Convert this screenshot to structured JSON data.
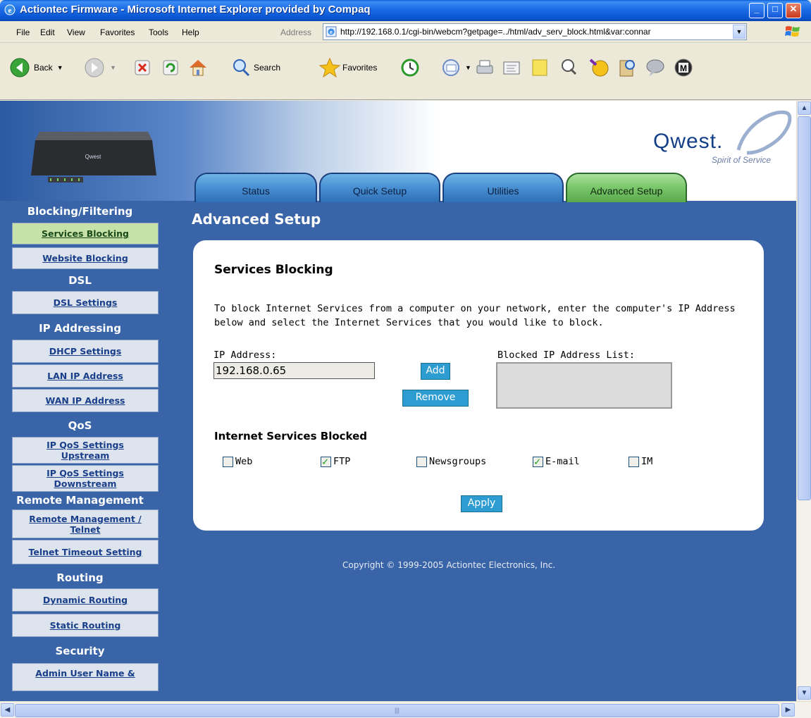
{
  "window": {
    "title": "Actiontec Firmware - Microsoft Internet Explorer provided by Compaq"
  },
  "menu": [
    "File",
    "Edit",
    "View",
    "Favorites",
    "Tools",
    "Help"
  ],
  "address": {
    "label": "Address",
    "url": "http://192.168.0.1/cgi-bin/webcm?getpage=../html/adv_serv_block.html&var:connar"
  },
  "toolbar": {
    "back": "Back",
    "search": "Search",
    "favorites": "Favorites"
  },
  "brand": {
    "name": "Qwest.",
    "tagline": "Spirit of Service"
  },
  "tabs": [
    "Status",
    "Quick Setup",
    "Utilities",
    "Advanced Setup"
  ],
  "sidebar": {
    "sections": [
      {
        "head": "Blocking/Filtering",
        "links": [
          "Services Blocking",
          "Website Blocking"
        ]
      },
      {
        "head": "DSL",
        "links": [
          "DSL Settings"
        ]
      },
      {
        "head": "IP Addressing",
        "links": [
          "DHCP Settings",
          "LAN IP Address",
          "WAN IP Address"
        ]
      },
      {
        "head": "QoS",
        "links": [
          "IP QoS Settings Upstream",
          "IP QoS Settings Downstream"
        ]
      },
      {
        "head": "Remote Management",
        "links": [
          "Remote Management / Telnet",
          "Telnet Timeout Setting"
        ]
      },
      {
        "head": "Routing",
        "links": [
          "Dynamic Routing",
          "Static Routing"
        ]
      },
      {
        "head": "Security",
        "links": [
          "Admin User Name &"
        ]
      }
    ]
  },
  "main": {
    "title": "Advanced Setup",
    "panel_title": "Services Blocking",
    "description": "To block Internet Services from a computer on your network, enter the computer's IP Address below and select the Internet Services that you would like to block.",
    "ip_label": "IP Address:",
    "ip_value": "192.168.0.65",
    "add": "Add",
    "remove": "Remove",
    "blocked_label": "Blocked IP Address List:",
    "services_head": "Internet Services Blocked",
    "services": [
      {
        "label": "Web",
        "checked": false
      },
      {
        "label": "FTP",
        "checked": true
      },
      {
        "label": "Newsgroups",
        "checked": false
      },
      {
        "label": "E-mail",
        "checked": true
      },
      {
        "label": "IM",
        "checked": false
      }
    ],
    "apply": "Apply"
  },
  "copyright": "Copyright © 1999-2005 Actiontec Electronics, Inc."
}
